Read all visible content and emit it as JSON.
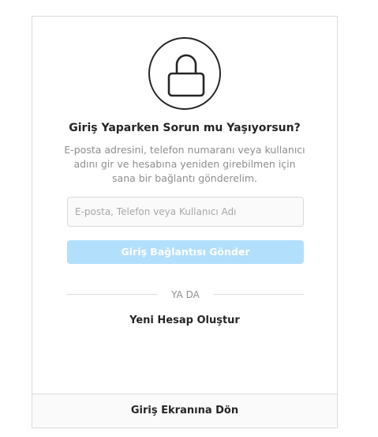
{
  "reset": {
    "icon": "lock-icon",
    "title": "Giriş Yaparken Sorun mu Yaşıyorsun?",
    "description": "E-posta adresini, telefon numaranı veya kullanıcı adını gir ve hesabına yeniden girebilmen için sana bir bağlantı gönderelim.",
    "input_placeholder": "E-posta, Telefon veya Kullanıcı Adı",
    "input_value": "",
    "send_button_label": "Giriş Bağlantısı Gönder",
    "divider_label": "YA DA",
    "create_account_label": "Yeni Hesap Oluştur"
  },
  "footer": {
    "back_label": "Giriş Ekranına Dön"
  },
  "colors": {
    "button_disabled": "#b2dffc",
    "text_primary": "#262626",
    "text_secondary": "#8e8e8e",
    "border": "#dbdbdb"
  }
}
